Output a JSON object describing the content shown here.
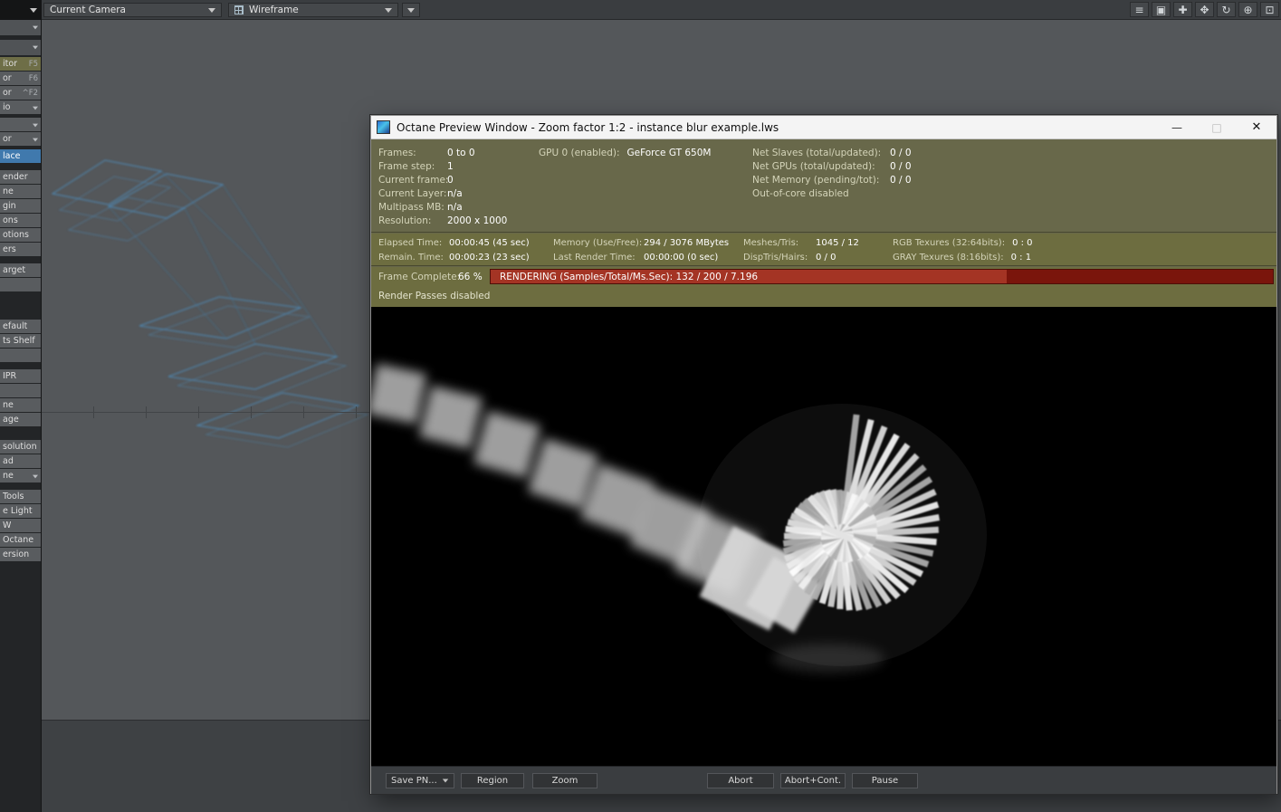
{
  "topbar": {
    "camera_dropdown": "Current Camera",
    "shading_dropdown": "Wireframe",
    "icons": [
      {
        "name": "menu-icon",
        "glyph": "≡"
      },
      {
        "name": "save-icon",
        "glyph": "▣"
      },
      {
        "name": "pan-icon",
        "glyph": "✚"
      },
      {
        "name": "move-icon",
        "glyph": "✥"
      },
      {
        "name": "rotate-icon",
        "glyph": "↻"
      },
      {
        "name": "zoom-in-icon",
        "glyph": "⊕"
      },
      {
        "name": "fit-view-icon",
        "glyph": "⊡"
      }
    ]
  },
  "sidebar": {
    "items": [
      {
        "kind": "dropdown",
        "label": "",
        "gap": 0,
        "tall": true
      },
      {
        "kind": "dropdown",
        "label": "",
        "gap": 5,
        "tall": true
      },
      {
        "kind": "button",
        "label": "itor",
        "shortcut": "F5",
        "accent": "olive",
        "gap": 2
      },
      {
        "kind": "button",
        "label": "or",
        "shortcut": "F6",
        "gap": 0
      },
      {
        "kind": "button",
        "label": "or",
        "shortcut": "^F2",
        "gap": 0
      },
      {
        "kind": "dropdown",
        "label": "io",
        "gap": 0
      },
      {
        "kind": "dropdown",
        "label": "",
        "gap": 4
      },
      {
        "kind": "dropdown",
        "label": "or",
        "gap": 0
      },
      {
        "kind": "button",
        "label": "lace",
        "selected": true,
        "gap": 4
      },
      {
        "kind": "button",
        "label": "ender",
        "gap": 8
      },
      {
        "kind": "button",
        "label": "ne",
        "gap": 0
      },
      {
        "kind": "button",
        "label": "gin",
        "gap": 0
      },
      {
        "kind": "button",
        "label": "ons",
        "gap": 0
      },
      {
        "kind": "button",
        "label": "otions",
        "gap": 0
      },
      {
        "kind": "button",
        "label": "ers",
        "gap": 0
      },
      {
        "kind": "button",
        "label": "arget",
        "gap": 8
      },
      {
        "kind": "button",
        "label": "",
        "gap": 0
      },
      {
        "kind": "button",
        "label": "efault",
        "gap": 31
      },
      {
        "kind": "button",
        "label": "ts Shelf",
        "gap": 0
      },
      {
        "kind": "button",
        "label": "",
        "gap": 0
      },
      {
        "kind": "button",
        "label": "IPR",
        "gap": 8
      },
      {
        "kind": "button",
        "label": "",
        "gap": 0
      },
      {
        "kind": "button",
        "label": "ne",
        "gap": 0
      },
      {
        "kind": "button",
        "label": "age",
        "gap": 0
      },
      {
        "kind": "button",
        "label": "solution",
        "gap": 15
      },
      {
        "kind": "button",
        "label": "ad",
        "gap": 0
      },
      {
        "kind": "dropdown",
        "label": "ne",
        "gap": 0
      },
      {
        "kind": "button",
        "label": "Tools",
        "gap": 8
      },
      {
        "kind": "button",
        "label": "e Light",
        "gap": 0
      },
      {
        "kind": "button",
        "label": "W",
        "gap": 0
      },
      {
        "kind": "button",
        "label": "Octane",
        "gap": 0
      },
      {
        "kind": "button",
        "label": "ersion",
        "gap": 0
      }
    ]
  },
  "window": {
    "title": "Octane Preview Window - Zoom factor 1:2 - instance blur example.lws",
    "minimize_glyph": "—",
    "maximize_glyph": "□",
    "close_glyph": "✕"
  },
  "info": {
    "left": [
      {
        "label": "Frames:",
        "value": "0 to 0"
      },
      {
        "label": "Frame step:",
        "value": "1"
      },
      {
        "label": "Current frame:",
        "value": "0"
      },
      {
        "label": "Current Layer:",
        "value": "n/a"
      },
      {
        "label": "Multipass MB:",
        "value": "n/a"
      },
      {
        "label": "Resolution:",
        "value": "2000 x 1000"
      }
    ],
    "gpu": {
      "label": "GPU  0 (enabled):",
      "value": "GeForce GT 650M"
    },
    "net": [
      {
        "label": "Net Slaves (total/updated):",
        "value": "0 / 0"
      },
      {
        "label": "Net GPUs (total/updated):",
        "value": "0 / 0"
      },
      {
        "label": "Net Memory (pending/tot):",
        "value": "0 / 0"
      },
      {
        "label": "Out-of-core disabled",
        "value": ""
      }
    ]
  },
  "status": {
    "rows": [
      [
        {
          "label": "Elapsed Time:",
          "value": "00:00:45 (45 sec)"
        },
        {
          "label": "Memory (Use/Free):",
          "value": "294 / 3076 MBytes"
        },
        {
          "label": "Meshes/Tris:",
          "value": "1045 / 12"
        },
        {
          "label": "RGB Texures (32:64bits):",
          "value": "0 : 0"
        }
      ],
      [
        {
          "label": "Remain. Time:",
          "value": "00:00:23 (23 sec)"
        },
        {
          "label": "Last Render Time:",
          "value": "00:00:00 (0 sec)"
        },
        {
          "label": "DispTris/Hairs:",
          "value": "0 / 0"
        },
        {
          "label": "GRAY Texures (8:16bits):",
          "value": "0 : 1"
        }
      ]
    ],
    "frame_complete_label": "Frame Complete:",
    "frame_complete_value": "66 %",
    "progress_percent": 66,
    "progress_text": "RENDERING (Samples/Total/Ms.Sec): 132 / 200 / 7.196",
    "render_passes": "Render Passes disabled"
  },
  "footer": {
    "buttons": [
      "Save PN...",
      "Region",
      "Zoom",
      "Abort",
      "Abort+Cont.",
      "Pause"
    ]
  },
  "colors": {
    "accent_blue": "#4079ad",
    "progress_red": "#a43424",
    "panel_olive": "#68684a"
  }
}
